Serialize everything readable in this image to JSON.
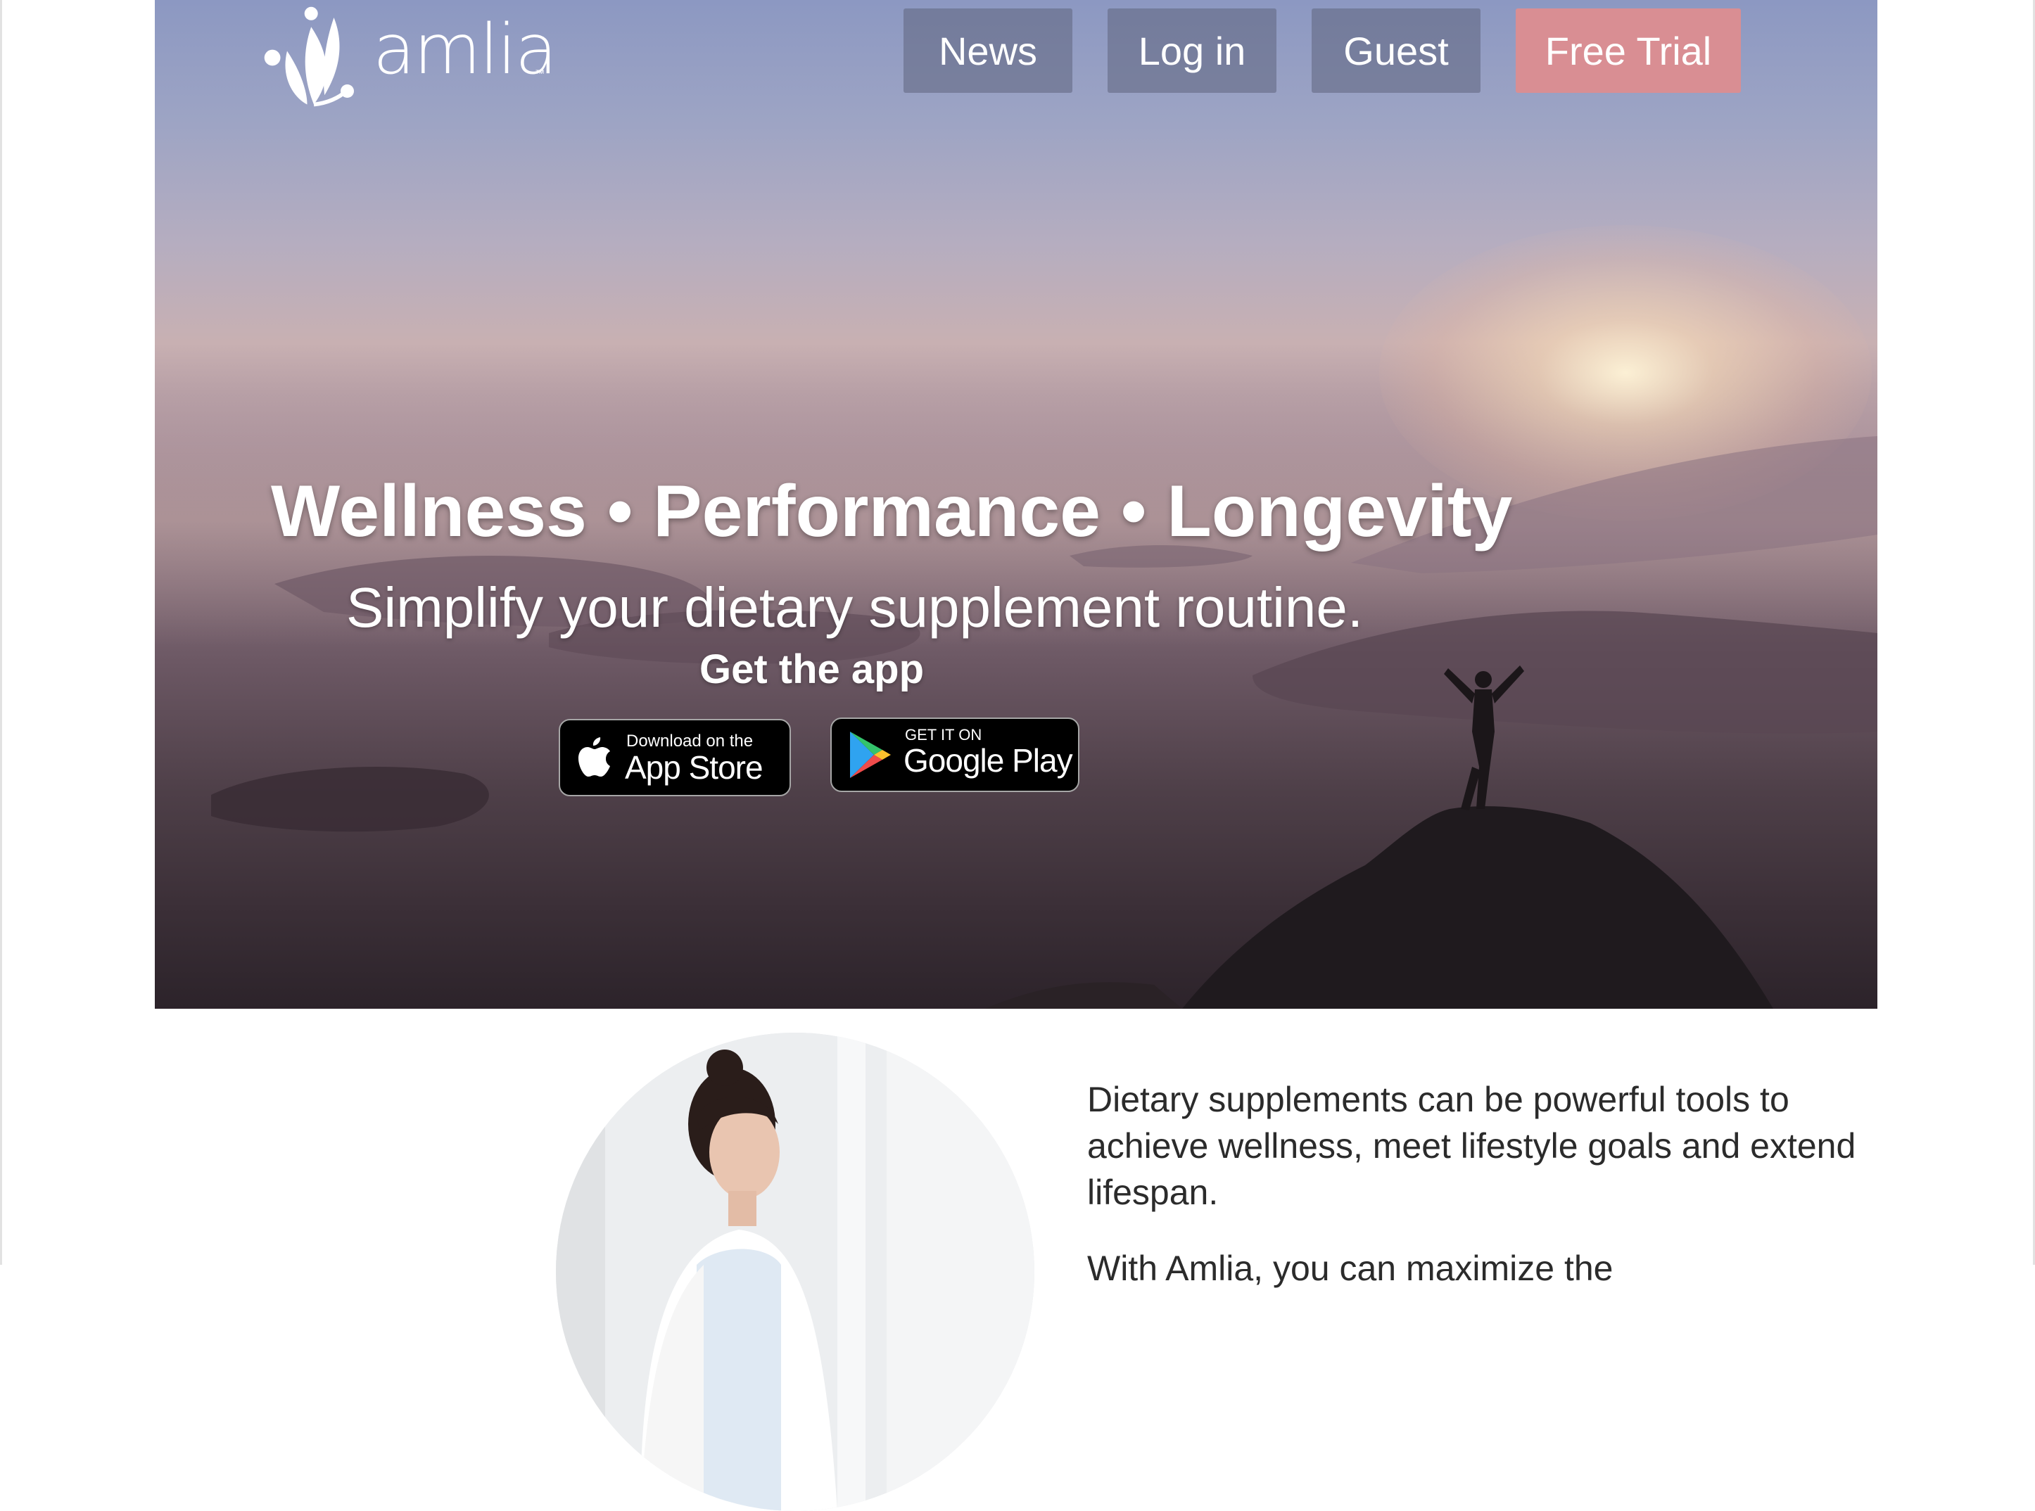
{
  "brand": {
    "name": "amlia",
    "tm": "™"
  },
  "nav": {
    "news": "News",
    "login": "Log in",
    "guest": "Guest",
    "trial": "Free Trial"
  },
  "hero": {
    "headline": "Wellness • Performance • Longevity",
    "subline": "Simplify your dietary supplement routine.",
    "cta": "Get the app"
  },
  "stores": {
    "apple": {
      "small": "Download on the",
      "big": "App Store"
    },
    "google": {
      "small": "GET IT ON",
      "big": "Google Play"
    }
  },
  "intro": {
    "paragraph": "Dietary supplements can be powerful tools to achieve wellness, meet lifestyle goals and extend lifespan.",
    "next_line_partial": "With Amlia, you can maximize the"
  },
  "colors": {
    "trial_button": "#d98e93",
    "nav_button": "#5f647d",
    "body_text": "#2b2b2b"
  }
}
